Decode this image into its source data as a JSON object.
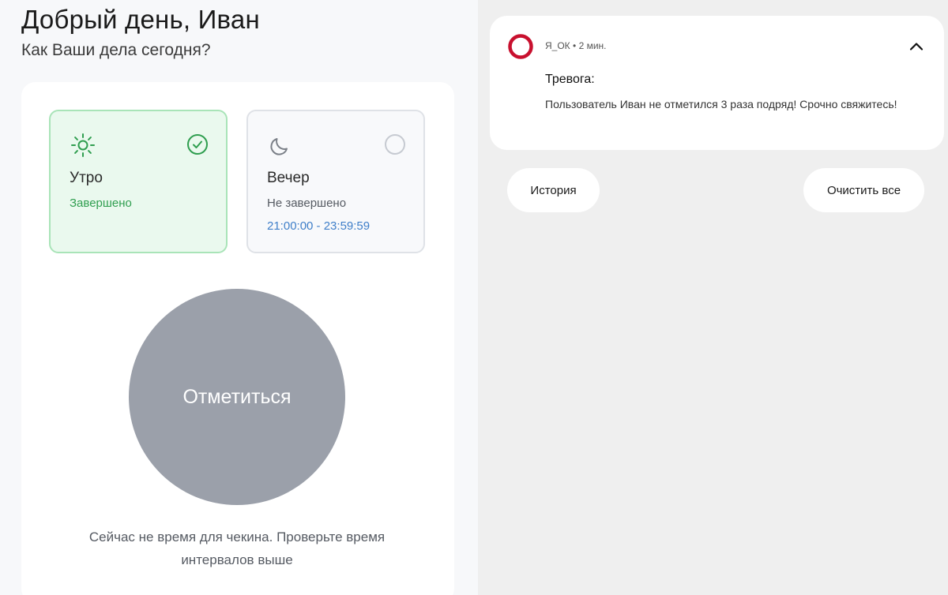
{
  "header": {
    "greeting": "Добрый день, Иван",
    "subtitle": "Как Ваши дела сегодня?"
  },
  "slots": [
    {
      "title": "Утро",
      "status": "Завершено",
      "icon": "sun-icon",
      "status_icon": "check-circle-icon"
    },
    {
      "title": "Вечер",
      "status": "Не завершено",
      "time": "21:00:00 - 23:59:59",
      "icon": "moon-icon",
      "status_icon": "empty-circle-icon"
    }
  ],
  "checkin": {
    "button_label": "Отметиться",
    "note": "Сейчас не время для чекина. Проверьте время интервалов выше"
  },
  "notification": {
    "app_name": "Я_ОК",
    "time_ago": "2 мин.",
    "title": "Тревога:",
    "body": "Пользователь Иван не отметился 3 раза подряд! Срочно свяжитесь!",
    "logo_icon": "app-ring-logo-icon",
    "collapse_icon": "chevron-up-icon"
  },
  "actions": {
    "history_label": "История",
    "clear_label": "Очистить все"
  },
  "colors": {
    "accent_green": "#2f9e4f",
    "time_blue": "#3f7fc9",
    "button_gray": "#9ba0aa",
    "logo_red": "#c8102e"
  }
}
